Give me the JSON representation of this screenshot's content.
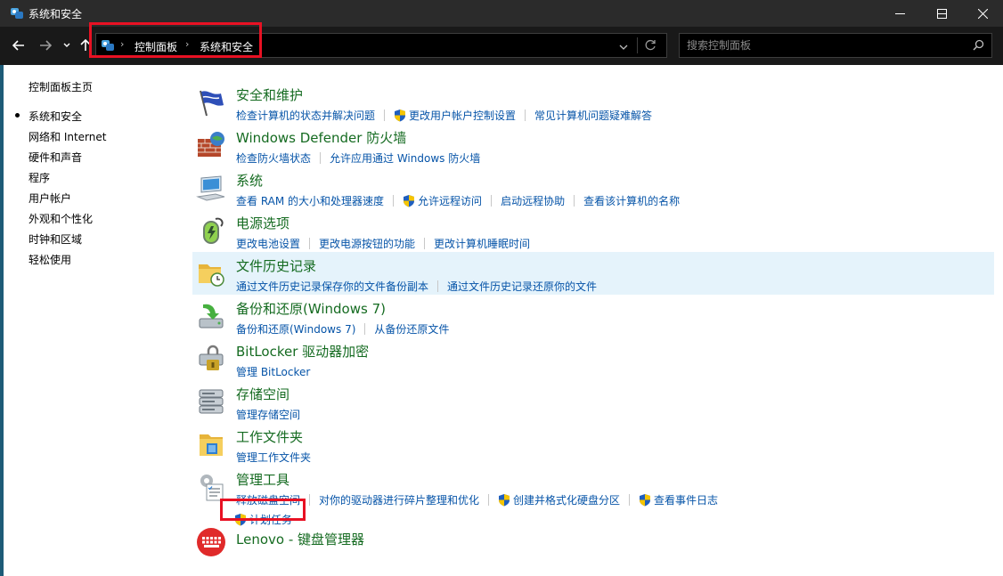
{
  "window": {
    "title": "系统和安全"
  },
  "navigation": {
    "breadcrumbs": [
      "控制面板",
      "系统和安全"
    ],
    "search": {
      "placeholder": "搜索控制面板",
      "value": ""
    }
  },
  "sidebar": {
    "home": "控制面板主页",
    "items": [
      {
        "label": "系统和安全",
        "current": true
      },
      {
        "label": "网络和 Internet"
      },
      {
        "label": "硬件和声音"
      },
      {
        "label": "程序"
      },
      {
        "label": "用户帐户"
      },
      {
        "label": "外观和个性化"
      },
      {
        "label": "时钟和区域"
      },
      {
        "label": "轻松使用"
      }
    ]
  },
  "categories": [
    {
      "title": "安全和维护",
      "icon": "flag-icon",
      "links": [
        "检查计算机的状态并解决问题",
        "更改用户帐户控制设置",
        "常见计算机问题疑难解答"
      ]
    },
    {
      "title": "Windows Defender 防火墙",
      "icon": "firewall-icon",
      "links": [
        "检查防火墙状态",
        "允许应用通过 Windows 防火墙"
      ]
    },
    {
      "title": "系统",
      "icon": "computer-icon",
      "links": [
        "查看 RAM 的大小和处理器速度",
        "允许远程访问",
        "启动远程协助",
        "查看该计算机的名称"
      ]
    },
    {
      "title": "电源选项",
      "icon": "power-icon",
      "links": [
        "更改电池设置",
        "更改电源按钮的功能",
        "更改计算机睡眠时间"
      ]
    },
    {
      "title": "文件历史记录",
      "icon": "file-history-icon",
      "links": [
        "通过文件历史记录保存你的文件备份副本",
        "通过文件历史记录还原你的文件"
      ]
    },
    {
      "title": "备份和还原(Windows 7)",
      "icon": "backup-icon",
      "links": [
        "备份和还原(Windows 7)",
        "从备份还原文件"
      ]
    },
    {
      "title": "BitLocker 驱动器加密",
      "icon": "bitlocker-icon",
      "links": [
        "管理 BitLocker"
      ]
    },
    {
      "title": "存储空间",
      "icon": "storage-icon",
      "links": [
        "管理存储空间"
      ]
    },
    {
      "title": "工作文件夹",
      "icon": "work-folders-icon",
      "links": [
        "管理工作文件夹"
      ]
    },
    {
      "title": "管理工具",
      "icon": "admin-tools-icon",
      "links": [
        "释放磁盘空间",
        "对你的驱动器进行碎片整理和优化",
        "创建并格式化硬盘分区",
        "查看事件日志",
        "计划任务"
      ]
    },
    {
      "title": "Lenovo - 键盘管理器",
      "icon": "keyboard-icon",
      "links": []
    }
  ],
  "colors": {
    "title_green": "#156b21",
    "link_blue": "#0654a8",
    "highlight_red": "#e81123",
    "hover_bg": "#e5f3fb",
    "titlebar_bg": "#2b2b2b",
    "navbar_bg": "#191919"
  }
}
